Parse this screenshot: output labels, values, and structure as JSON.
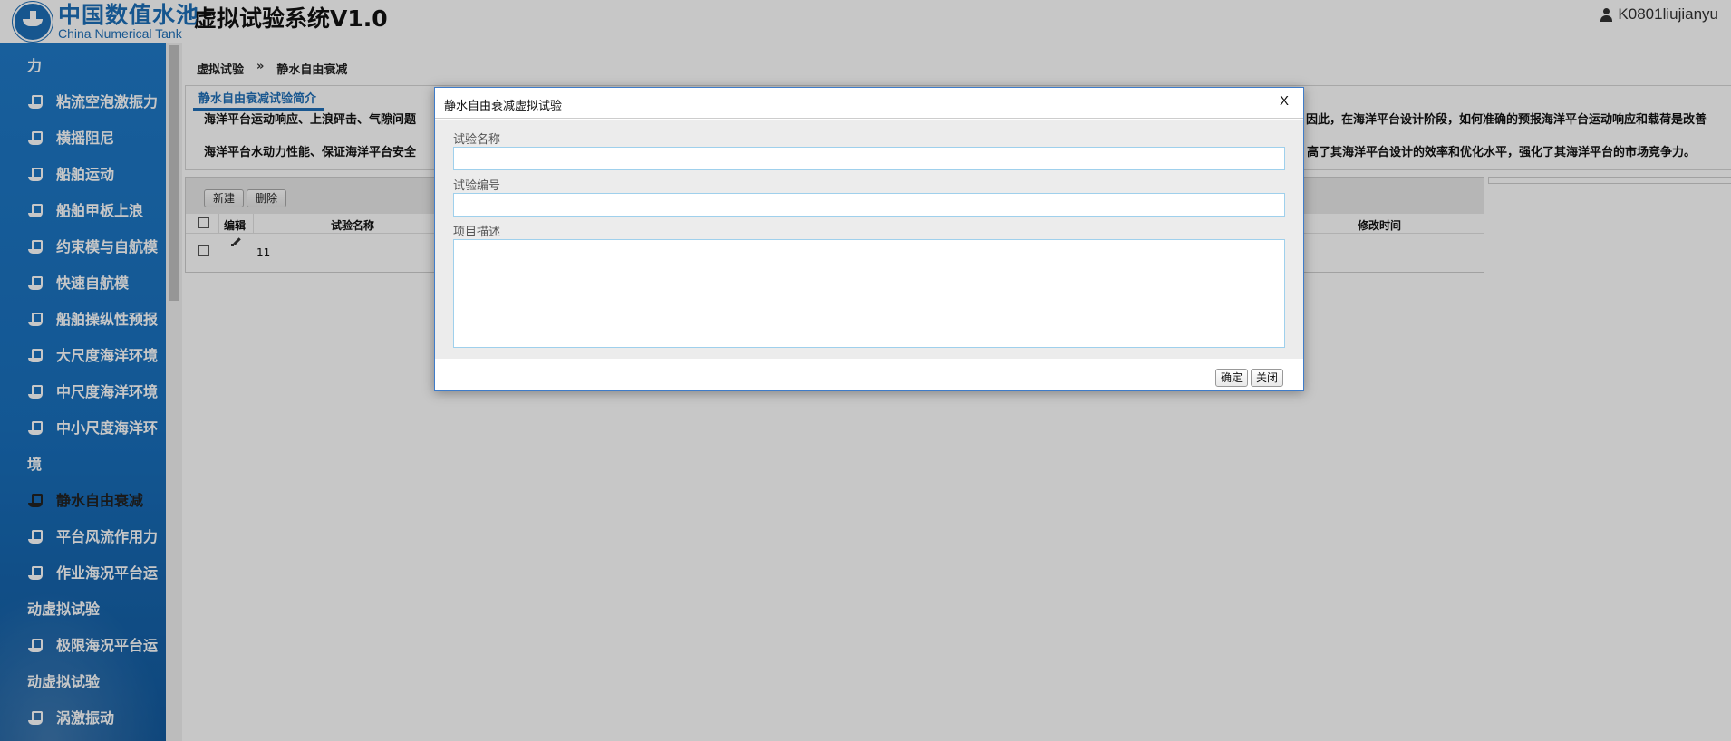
{
  "header": {
    "logo_cn": "中国数值水池",
    "logo_en": "China Numerical Tank",
    "app_title": "虚拟试验系统V1.0",
    "username": "K0801liujianyu"
  },
  "sidebar": {
    "items": [
      {
        "label": "力",
        "icon": "ship-icon",
        "wrapped": true
      },
      {
        "label": "粘流空泡激振力",
        "icon": "ship-icon"
      },
      {
        "label": "横摇阻尼",
        "icon": "ship-icon"
      },
      {
        "label": "船舶运动",
        "icon": "ship-icon"
      },
      {
        "label": "船舶甲板上浪",
        "icon": "ship-icon"
      },
      {
        "label": "约束模与自航模",
        "icon": "ship-icon"
      },
      {
        "label": "快速自航模",
        "icon": "ship-icon"
      },
      {
        "label": "船舶操纵性预报",
        "icon": "ship-icon"
      },
      {
        "label": "大尺度海洋环境",
        "icon": "ship-icon"
      },
      {
        "label": "中尺度海洋环境",
        "icon": "ship-icon"
      },
      {
        "label": "中小尺度海洋环",
        "icon": "ship-icon"
      },
      {
        "label": "境",
        "wrapped": true
      },
      {
        "label": "静水自由衰减",
        "icon": "ship-icon",
        "active": true
      },
      {
        "label": "平台风流作用力",
        "icon": "ship-icon"
      },
      {
        "label": "作业海况平台运",
        "icon": "ship-icon"
      },
      {
        "label": "动虚拟试验",
        "wrapped": true
      },
      {
        "label": "极限海况平台运",
        "icon": "ship-icon"
      },
      {
        "label": "动虚拟试验",
        "wrapped": true
      },
      {
        "label": "涡激振动",
        "icon": "ship-icon"
      }
    ],
    "accent_color": "#1f7ac8"
  },
  "breadcrumb": {
    "root": "虚拟试验",
    "separator": "»",
    "current": "静水自由衰减"
  },
  "intro": {
    "tab_label": "静水自由衰减试验简介",
    "line1_left": "海洋平台运动响应、上浪砰击、气隙问题",
    "line1_right": "因此，在海洋平台设计阶段，如何准确的预报海洋平台运动响应和载荷是改善",
    "line2_left": "海洋平台水动力性能、保证海洋平台安全",
    "line2_right": "高了其海洋平台设计的效率和优化水平，强化了其海洋平台的市场竞争力。"
  },
  "grid": {
    "toolbar": {
      "new_label": "新建",
      "delete_label": "删除"
    },
    "columns": {
      "edit": "编辑",
      "name": "试验名称",
      "modified": "修改时间"
    },
    "rows": [
      {
        "name": "11",
        "modified": ""
      }
    ]
  },
  "modal": {
    "title": "静水自由衰减虚拟试验",
    "close_label": "X",
    "fields": {
      "name_label": "试验名称",
      "name_value": "",
      "number_label": "试验编号",
      "number_value": "",
      "desc_label": "项目描述",
      "desc_value": ""
    },
    "confirm_label": "确定",
    "close_button_label": "关闭"
  }
}
